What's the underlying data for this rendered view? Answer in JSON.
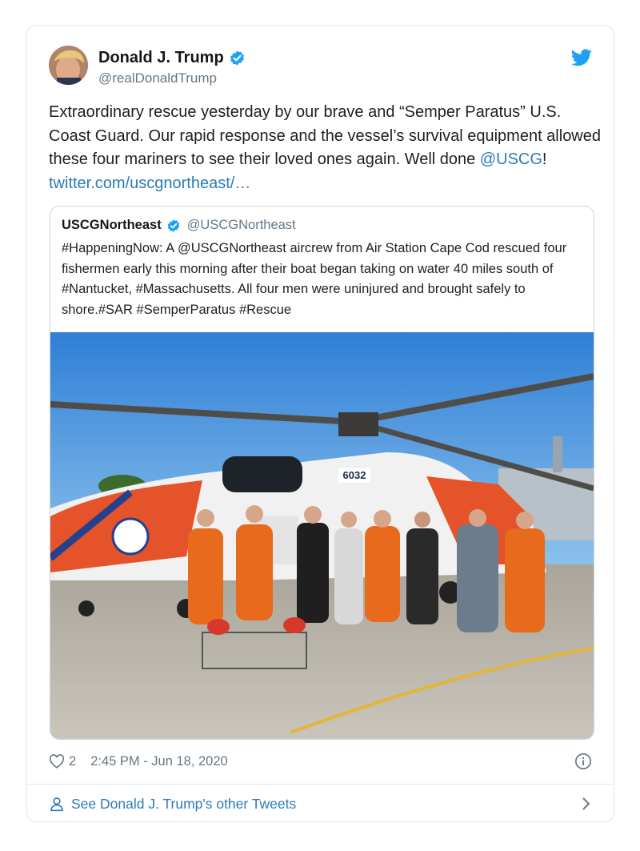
{
  "tweet": {
    "display_name": "Donald J. Trump",
    "handle": "@realDonaldTrump",
    "text_main": "Extraordinary rescue yesterday by our brave and “Semper Paratus” U.S. Coast Guard. Our rapid response and the vessel’s survival equipment allowed these four mariners to see their loved ones again. Well done ",
    "mention": "@USCG",
    "exclaim": "!",
    "link": "twitter.com/uscgnortheast/…",
    "likes": "2",
    "timestamp": "2:45 PM - Jun 18, 2020"
  },
  "quoted": {
    "display_name": "USCGNortheast",
    "handle": "@USCGNortheast",
    "text": "#HappeningNow: A @USCGNortheast aircrew from Air Station Cape Cod rescued four fishermen early this morning after their boat began taking on water 40 miles south of #Nantucket, #Massachusetts. All four men were uninjured and brought safely to shore.#SAR #SemperParatus #Rescue",
    "aircraft_number": "6032"
  },
  "footer": {
    "label": "See Donald J. Trump's other Tweets"
  },
  "icons": {
    "verified": "verified-badge-icon",
    "bird": "twitter-bird-icon",
    "heart": "heart-icon",
    "info": "info-icon",
    "person": "person-icon",
    "chevron": "chevron-right-icon"
  },
  "colors": {
    "link": "#2b7bb9",
    "verified": "#1da1f2",
    "muted": "#657786",
    "border": "#e1e8ed"
  }
}
